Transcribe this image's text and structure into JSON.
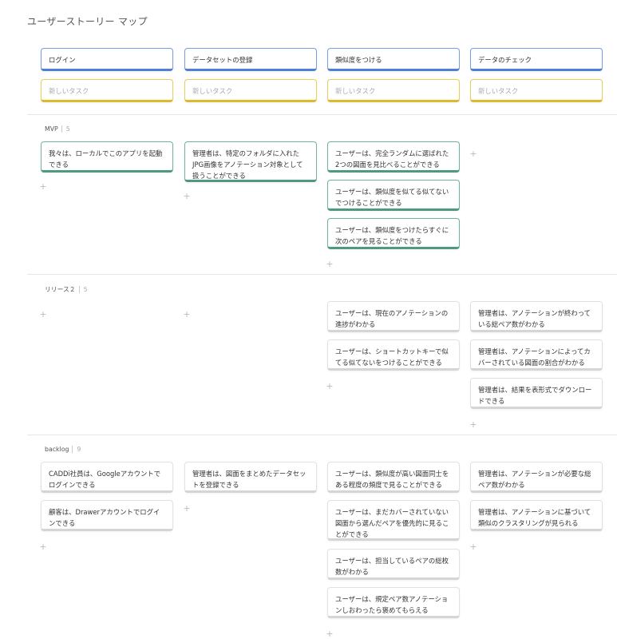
{
  "title": "ユーザーストーリー マップ",
  "epics": [
    "ログイン",
    "データセットの登録",
    "類似度をつける",
    "データのチェック"
  ],
  "task_placeholder": "新しいタスク",
  "plus": "+",
  "releases": [
    {
      "name": "MVP",
      "count": "5",
      "columns": [
        [
          "我々は、ローカルでこのアプリを起動できる"
        ],
        [
          "管理者は、特定のフォルダに入れたJPG画像をアノテーション対象として扱うことができる"
        ],
        [
          "ユーザーは、完全ランダムに選ばれた2つの図面を見比べることができる",
          "ユーザーは、類似度を似てる似てないでつけることができる",
          "ユーザーは、類似度をつけたらすぐに次のペアを見ることができる"
        ],
        []
      ]
    },
    {
      "name": "リリース２",
      "count": "5",
      "columns": [
        [],
        [],
        [
          "ユーザーは、現在のアノテーションの進捗がわかる",
          "ユーザーは、ショートカットキーで似てる似てないをつけることができる"
        ],
        [
          "管理者は、アノテーションが終わっている総ペア数がわかる",
          "管理者は、アノテーションによってカバーされている図面の割合がわかる",
          "管理者は、結果を表形式でダウンロードできる"
        ]
      ]
    },
    {
      "name": "backlog",
      "count": "9",
      "columns": [
        [
          "CADDi社員は、Googleアカウントでログインできる",
          "顧客は、Drawerアカウントでログインできる"
        ],
        [
          "管理者は、図面をまとめたデータセットを登録できる"
        ],
        [
          "ユーザーは、類似度が高い図面同士をある程度の頻度で見ることができる",
          "ユーザーは、まだカバーされていない図面から選んだペアを優先的に見ることができる",
          "ユーザーは、担当しているペアの総枚数がわかる",
          "ユーザーは、規定ペア数アノテーションしおわったら褒めてもらえる"
        ],
        [
          "管理者は、アノテーションが必要な総ペア数がわかる",
          "管理者は、アノテーションに基づいて類似のクラスタリングが見られる"
        ]
      ]
    }
  ]
}
